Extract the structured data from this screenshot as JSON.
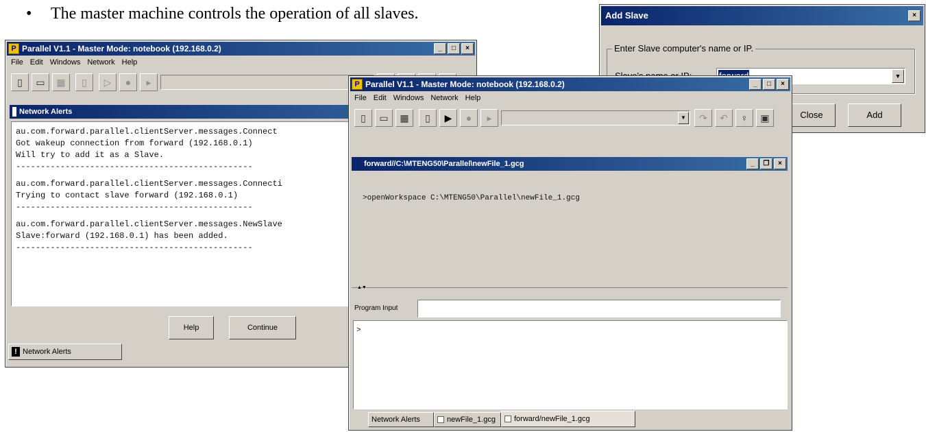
{
  "slide": {
    "bullet": "•",
    "text": "The master machine controls the operation of all slaves."
  },
  "win1": {
    "icon": "P",
    "title": "Parallel V1.1  - Master Mode: notebook (192.168.0.2)",
    "menu": [
      "File",
      "Edit",
      "Windows",
      "Network",
      "Help"
    ],
    "alerts_title": "Network Alerts",
    "log_lines": [
      "au.com.forward.parallel.clientServer.messages.Connect",
      "Got wakeup connection from forward (192.168.0.1)",
      "Will try to add it as a Slave.",
      "------------------------------------------------",
      "au.com.forward.parallel.clientServer.messages.Connecti",
      "Trying to contact slave forward (192.168.0.1)",
      "------------------------------------------------",
      "au.com.forward.parallel.clientServer.messages.NewSlave",
      "Slave:forward (192.168.0.1) has been added.",
      "------------------------------------------------"
    ],
    "help_label": "Help",
    "continue_label": "Continue",
    "tab_label": "Network Alerts"
  },
  "win2": {
    "icon": "P",
    "title": "Parallel V1.1  - Master Mode: notebook (192.168.0.2)",
    "menu": [
      "File",
      "Edit",
      "Windows",
      "Network",
      "Help"
    ],
    "inner_title": "forward//C:\\MTENG50\\Parallel\\newFile_1.gcg",
    "workspace_line": ">openWorkspace C:\\MTENG50\\Parallel\\newFile_1.gcg",
    "program_input_label": "Program Input",
    "program_input_value": "",
    "output_text": ">",
    "tabs": [
      "Network Alerts",
      "newFile_1.gcg",
      "forward/newFile_1.gcg"
    ]
  },
  "dialog": {
    "title": "Add Slave",
    "group_label": "Enter Slave computer's name or IP.",
    "field_label": "Slave's name or IP:",
    "field_value": "forward",
    "close_label": "Close",
    "add_label": "Add"
  }
}
